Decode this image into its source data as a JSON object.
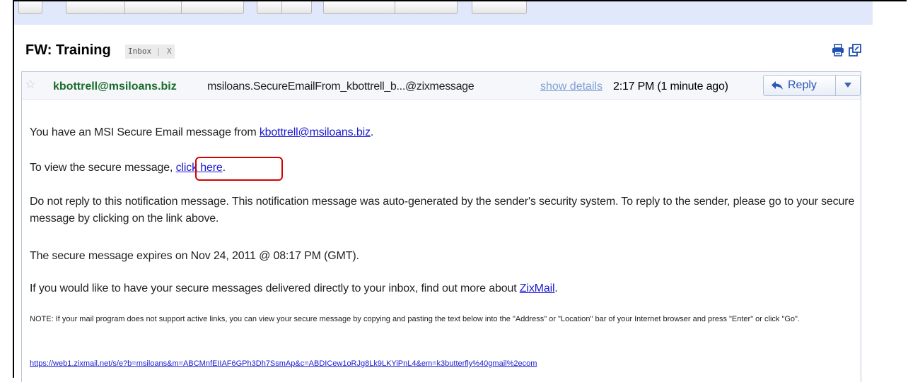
{
  "subject": {
    "title": "FW: Training",
    "label": "Inbox",
    "label_remove": "X"
  },
  "header_icons": {
    "print": "print-icon",
    "new_window": "new-window-icon"
  },
  "message": {
    "star_icon": "star-icon",
    "sender": "kbottrell@msiloans.biz",
    "to": "msiloans.SecureEmailFrom_kbottrell_b...@zixmessage",
    "show_details": "show details",
    "time": "2:17 PM (1 minute ago)",
    "reply_label": "Reply",
    "reply_icon": "reply-arrow-icon",
    "more_icon": "dropdown-arrow-icon"
  },
  "body": {
    "line1_prefix": "You have an MSI Secure Email message from",
    "line1_link": "kbottrell@msiloans.biz",
    "line1_suffix": ".",
    "line2_prefix": "To view the secure message",
    "line2_comma": ", ",
    "line2_link": "click here",
    "line2_suffix": ".",
    "line3": "Do not reply to this notification message. This notification message was auto-generated by the sender's security system. To reply to the sender, please go to your secure message by clicking on the link above.",
    "line4": "The secure message expires on Nov 24, 2011 @ 08:17 PM (GMT).",
    "line5_prefix": "If you would like to have your secure messages delivered directly to your inbox, find out more about",
    "line5_link": "ZixMail",
    "line5_suffix": ".",
    "note": "NOTE: If your mail program does not support active links, you can view your secure message by copying and pasting the text below into the \"Address\" or \"Location\" bar of your Internet browser and press \"Enter\" or click \"Go\".",
    "url": "https://web1.zixmail.net/s/e?b=msiloans&m=ABCMnfEIIAF6GPh3Dh7SsmAp&c=ABDICew1oRJg8Lk9LKYiPnL4&em=k3butterfly%40gmail%2ecom"
  },
  "colors": {
    "toolbar_bg": "#e1e8fb",
    "sender": "#1a6b2c",
    "link": "#1a1ad0",
    "highlight": "#d40000"
  }
}
